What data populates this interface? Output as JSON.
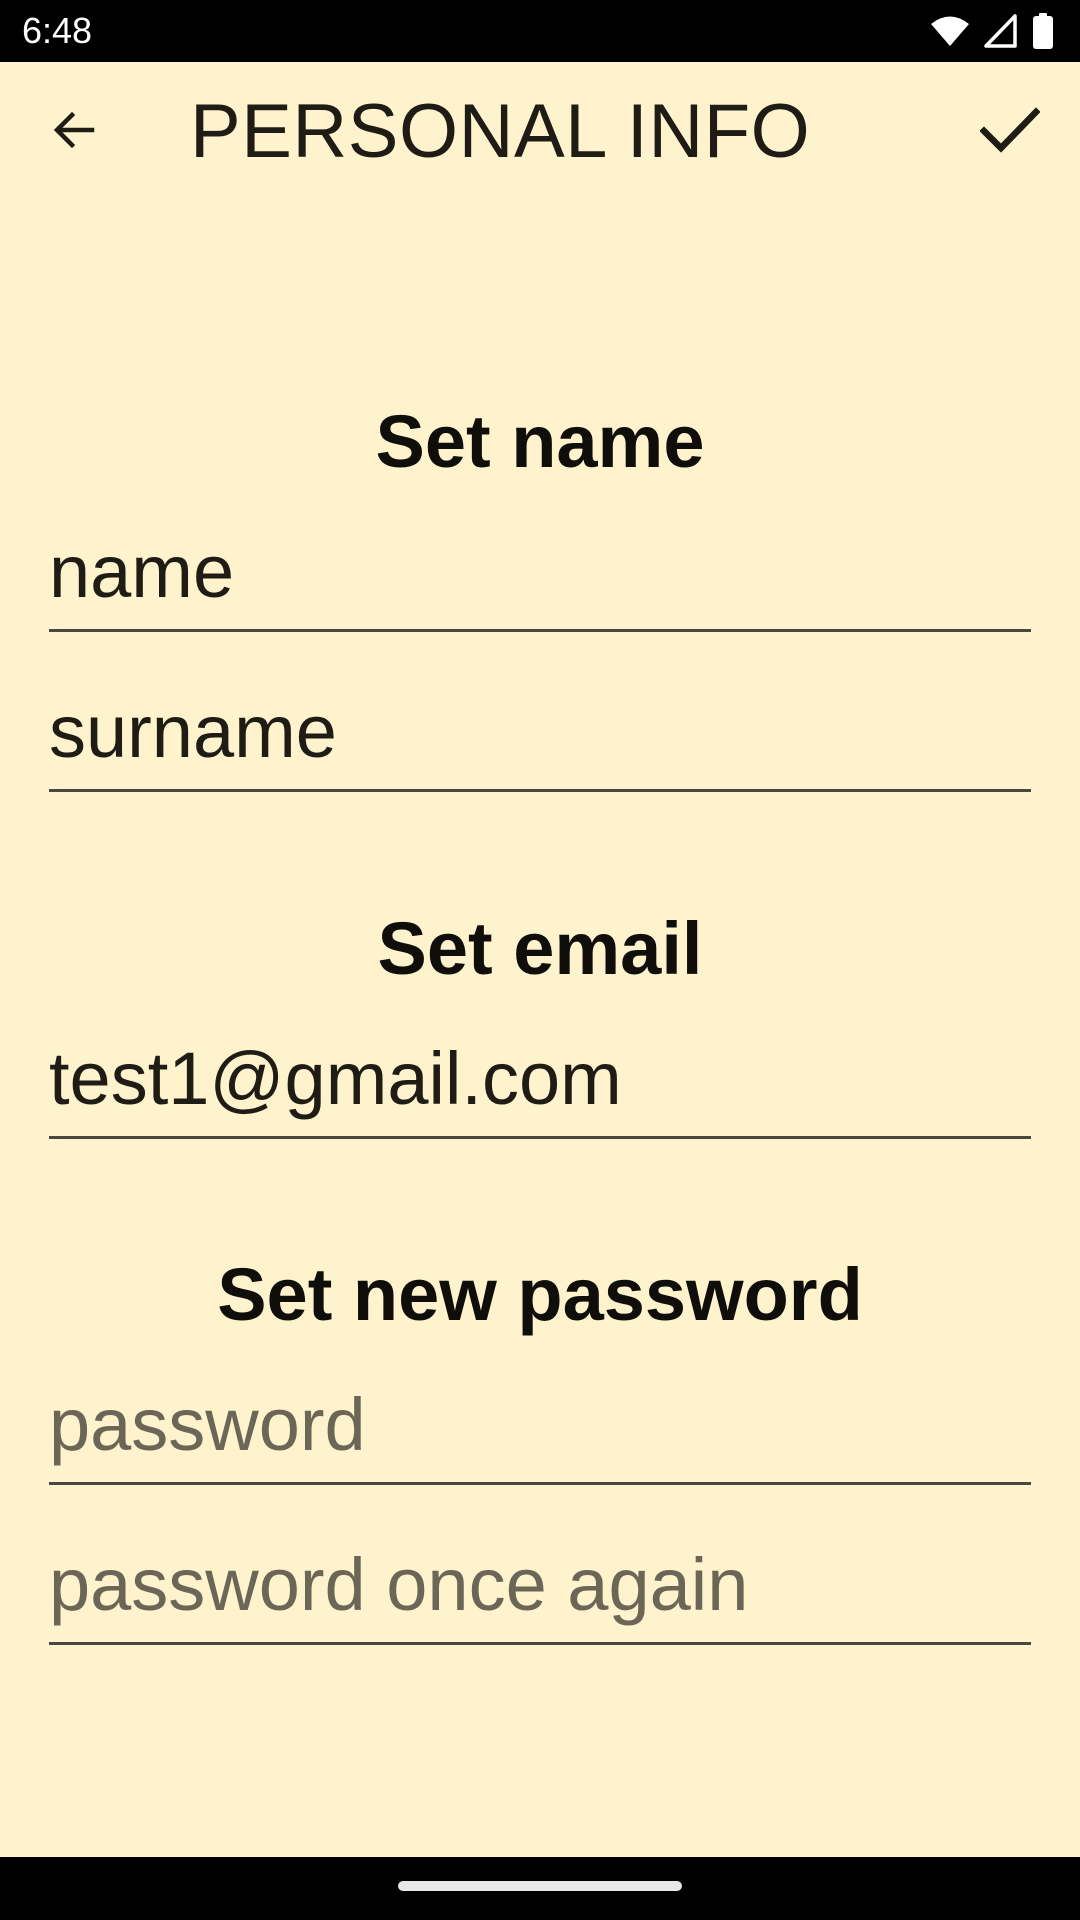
{
  "status_bar": {
    "time": "6:48",
    "icons": [
      "wifi-icon",
      "cellular-signal-icon",
      "battery-icon"
    ]
  },
  "app_bar": {
    "back_icon": "arrow-back-icon",
    "title": "PERSONAL INFO",
    "confirm_icon": "check-icon"
  },
  "name_section": {
    "heading": "Set name",
    "name_value": "name",
    "surname_value": "surname"
  },
  "email_section": {
    "heading": "Set email",
    "email_value": "test1@gmail.com"
  },
  "password_section": {
    "heading": "Set new password",
    "password_placeholder": "password",
    "password_confirm_placeholder": "password once again"
  },
  "colors": {
    "background": "#FEF3CD",
    "text": "#1F1C16",
    "placeholder": "#6B6656",
    "underline": "#4A473F"
  }
}
